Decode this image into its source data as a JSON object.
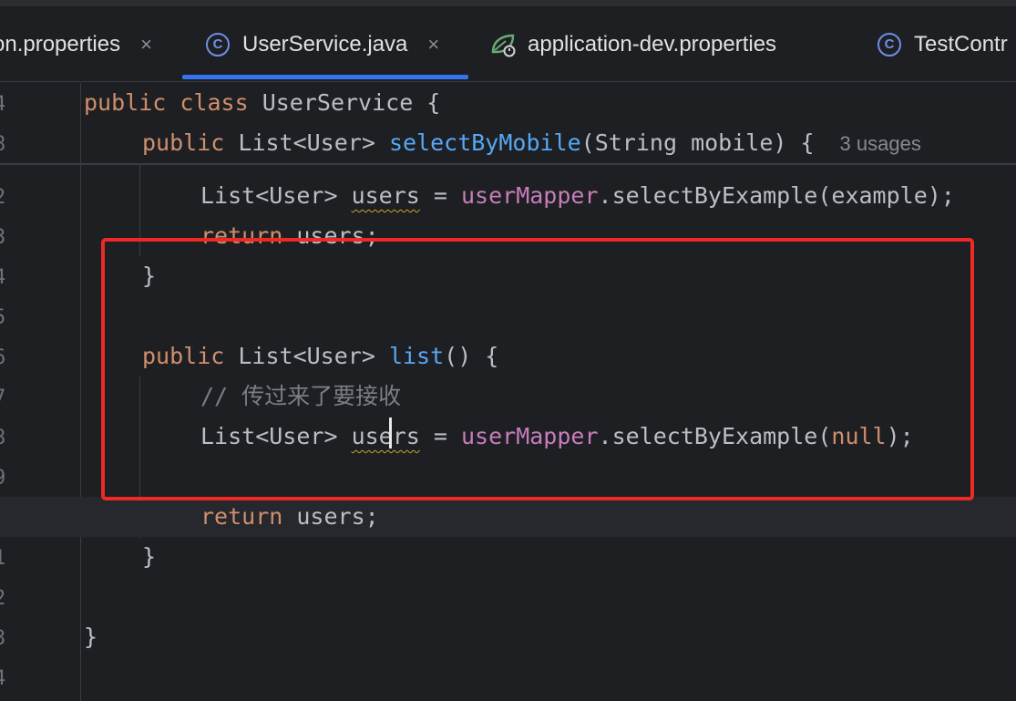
{
  "tabs": [
    {
      "label": "on.properties",
      "icon": "properties-file-icon",
      "closable": true
    },
    {
      "label": "UserService.java",
      "icon": "class-icon",
      "closable": true,
      "active": true
    },
    {
      "label": "application-dev.properties",
      "icon": "spring-leaf-icon",
      "closable": false
    },
    {
      "label": "TestContr",
      "icon": "class-icon",
      "closable": false
    }
  ],
  "tab_icon_letter": "C",
  "close_glyph": "×",
  "gutter": [
    "4",
    "8",
    "2",
    "3",
    "4",
    "5",
    "6",
    "7",
    "8",
    "9",
    "0",
    "1",
    "2",
    "3",
    "4"
  ],
  "code": {
    "sticky1_kw1": "public",
    "sticky1_kw2": "class",
    "sticky1_rest": " UserService {",
    "sticky2_kw": "public",
    "sticky2_type": " List<User> ",
    "sticky2_fn": "selectByMobile",
    "sticky2_rest": "(String mobile) {",
    "sticky2_hint": "3 usages",
    "l_users_type": "List<User> ",
    "l_users_var": "users",
    "l_users_eq": " = ",
    "l_users_field": "userMapper",
    "l_users_call": ".selectByExample(example);",
    "l_return_kw": "return",
    "l_return_rest": " users;",
    "close_brace": "}",
    "list_kw": "public",
    "list_type": " List<User> ",
    "list_fn": "list",
    "list_rest": "() {",
    "comment": "// 传过来了要接收",
    "null_call_a": ".selectByExample(",
    "null_kw": "null",
    "null_call_b": ");"
  },
  "colors": {
    "keyword": "#cf8e6d",
    "function": "#56a8f5",
    "field": "#c77dbb",
    "comment": "#7a7e85",
    "text": "#bcbec4",
    "highlight_box": "#ee2a25",
    "active_tab": "#3574f0"
  }
}
